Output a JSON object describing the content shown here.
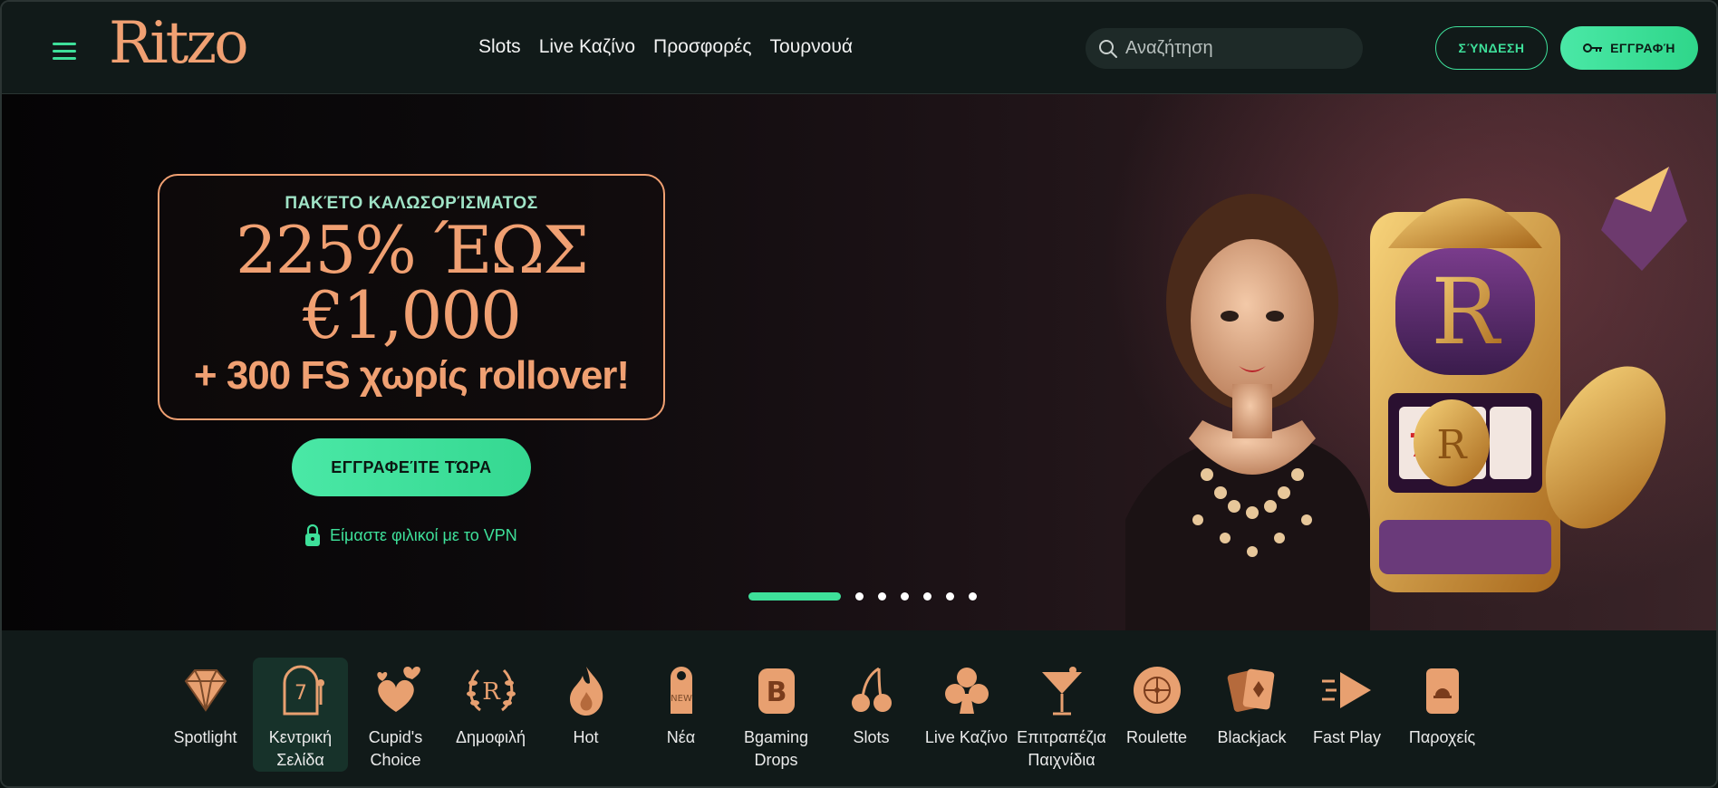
{
  "brand": {
    "logo_text": "Ritzo"
  },
  "nav": {
    "items": [
      "Slots",
      "Live Καζίνο",
      "Προσφορές",
      "Τουρνουά"
    ]
  },
  "search": {
    "placeholder": "Αναζήτηση"
  },
  "auth": {
    "login_label": "ΣΎΝΔΕΣΗ",
    "register_label": "ΕΓΓΡΑΦΉ"
  },
  "hero": {
    "kicker": "ΠΑΚΈΤΟ ΚΑΛΩΣΟΡΊΣΜΑΤΟΣ",
    "headline_1": "225% ΈΩΣ",
    "headline_2": "€1,000",
    "headline_3": "+ 300 FS χωρίς rollover!",
    "cta_label": "ΕΓΓΡΑΦΕΊΤΕ ΤΏΡΑ",
    "vpn_text": "Είμαστε φιλικοί με το VPN",
    "slides_total": 7,
    "active_slide": 1
  },
  "categories": [
    {
      "label": "Spotlight",
      "icon": "diamond-icon",
      "active": false
    },
    {
      "label": "Κεντρική Σελίδα",
      "icon": "slot-machine-icon",
      "active": true
    },
    {
      "label": "Cupid's Choice",
      "icon": "hearts-icon",
      "active": false
    },
    {
      "label": "Δημοφιλή",
      "icon": "laurel-r-icon",
      "active": false
    },
    {
      "label": "Hot",
      "icon": "flame-icon",
      "active": false
    },
    {
      "label": "Νέα",
      "icon": "new-tag-icon",
      "active": false
    },
    {
      "label": "Bgaming Drops",
      "icon": "bgaming-b-icon",
      "active": false
    },
    {
      "label": "Slots",
      "icon": "cherries-icon",
      "active": false
    },
    {
      "label": "Live Καζίνο",
      "icon": "club-icon",
      "active": false
    },
    {
      "label": "Επιτραπέζια Παιχνίδια",
      "icon": "cocktail-icon",
      "active": false
    },
    {
      "label": "Roulette",
      "icon": "roulette-icon",
      "active": false
    },
    {
      "label": "Blackjack",
      "icon": "cards-icon",
      "active": false
    },
    {
      "label": "Fast Play",
      "icon": "fast-play-icon",
      "active": false
    },
    {
      "label": "Παροχείς",
      "icon": "provider-card-icon",
      "active": false
    }
  ],
  "colors": {
    "accent_green": "#3ee09a",
    "accent_copper": "#f0a072",
    "bg": "#111a19"
  }
}
